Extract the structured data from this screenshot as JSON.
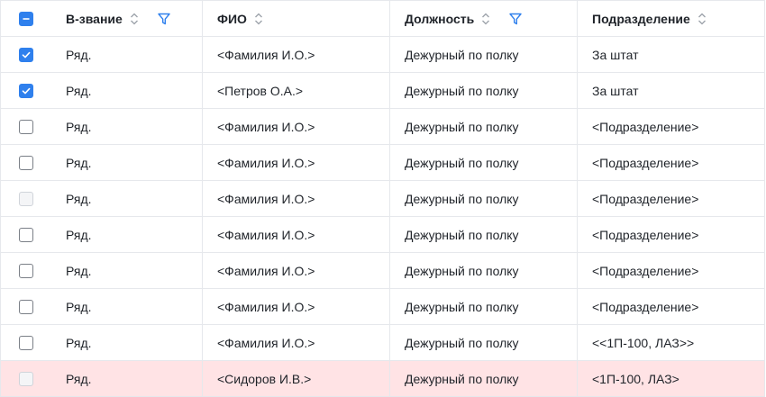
{
  "table": {
    "columns": {
      "rank": "В-звание",
      "fio": "ФИО",
      "position": "Должность",
      "unit": "Подразделение"
    },
    "select_all_state": "indeterminate",
    "rows": [
      {
        "checked": "checked",
        "rank": "Ряд.",
        "fio": "<Фамилия И.О.>",
        "position": "Дежурный по полку",
        "unit": "За штат"
      },
      {
        "checked": "checked",
        "rank": "Ряд.",
        "fio": "<Петров О.А.>",
        "position": "Дежурный по полку",
        "unit": "За штат"
      },
      {
        "checked": "unchecked",
        "rank": "Ряд.",
        "fio": "<Фамилия И.О.>",
        "position": "Дежурный по полку",
        "unit": "<Подразделение>"
      },
      {
        "checked": "unchecked",
        "rank": "Ряд.",
        "fio": "<Фамилия И.О.>",
        "position": "Дежурный по полку",
        "unit": "<Подразделение>"
      },
      {
        "checked": "disabled",
        "rank": "Ряд.",
        "fio": "<Фамилия И.О.>",
        "position": "Дежурный по полку",
        "unit": "<Подразделение>"
      },
      {
        "checked": "unchecked",
        "rank": "Ряд.",
        "fio": "<Фамилия И.О.>",
        "position": "Дежурный по полку",
        "unit": "<Подразделение>"
      },
      {
        "checked": "unchecked",
        "rank": "Ряд.",
        "fio": "<Фамилия И.О.>",
        "position": "Дежурный по полку",
        "unit": "<Подразделение>"
      },
      {
        "checked": "unchecked",
        "rank": "Ряд.",
        "fio": "<Фамилия И.О.>",
        "position": "Дежурный по полку",
        "unit": "<Подразделение>"
      },
      {
        "checked": "unchecked",
        "rank": "Ряд.",
        "fio": "<Фамилия И.О.>",
        "position": "Дежурный по полку",
        "unit": "<<1П-100, ЛАЗ>>"
      },
      {
        "checked": "disabled",
        "rank": "Ряд.",
        "fio": "<Сидоров И.В.>",
        "position": "Дежурный по полку",
        "unit": "<1П-100, ЛАЗ>",
        "highlighted": true
      }
    ]
  },
  "colors": {
    "accent": "#2f80ed",
    "highlight_row": "#ffe3e5",
    "border": "#e6e8ec"
  },
  "icons": {
    "sort": "sort-icon",
    "filter": "filter-icon",
    "check": "check-icon"
  }
}
